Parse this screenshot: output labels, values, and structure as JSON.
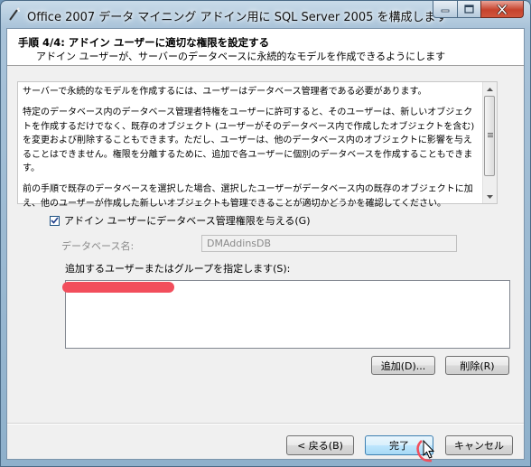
{
  "window": {
    "title": "Office 2007 データ マイニング アドイン用に SQL Server 2005 を構成します"
  },
  "header": {
    "step_title": "手順 4/4: アドイン ユーザーに適切な権限を設定する",
    "step_subtitle": "アドイン ユーザーが、サーバーのデータベースに永続的なモデルを作成できるようにします"
  },
  "description": {
    "paragraphs": [
      "サーバーで永続的なモデルを作成するには、ユーザーはデータベース管理者である必要があります。",
      "特定のデータベース内のデータベース管理者特権をユーザーに許可すると、そのユーザーは、新しいオブジェクトを作成するだけでなく、既存のオブジェクト (ユーザーがそのデータベース内で作成したオブジェクトを含む) を変更および削除することもできます。ただし、ユーザーは、他のデータベース内のオブジェクトに影響を与えることはできません。権限を分離するために、追加で各ユーザーに個別のデータベースを作成することもできます。",
      "前の手順で既存のデータベースを選択した場合、選択したユーザーがデータベース内の既存のオブジェクトに加え、他のユーザーが作成した新しいオブジェクトも管理できることが適切かどうかを確認してください。"
    ]
  },
  "grant_checkbox": {
    "label": "アドイン ユーザーにデータベース管理権限を与える(G)",
    "checked": true
  },
  "database": {
    "label": "データベース名:",
    "value": "DMAddinsDB"
  },
  "users": {
    "label": "追加するユーザーまたはグループを指定します(S):",
    "items": []
  },
  "buttons": {
    "add": "追加(D)...",
    "delete": "削除(R)",
    "back": "< 戻る(B)",
    "finish": "完了",
    "cancel": "キャンセル"
  },
  "colors": {
    "redaction": "#f24e5c",
    "close_button": "#c6432d",
    "default_button_border": "#3c7fb1"
  }
}
